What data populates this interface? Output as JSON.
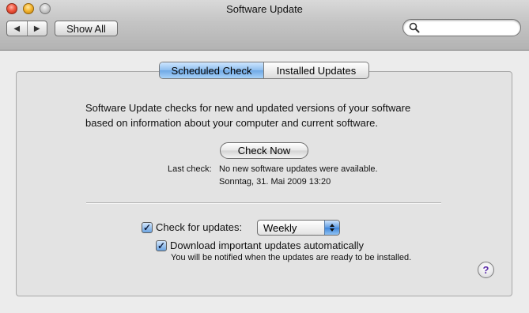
{
  "window": {
    "title": "Software Update"
  },
  "toolbar": {
    "back_icon": "triangle-left-icon",
    "forward_icon": "triangle-right-icon",
    "show_all_label": "Show All",
    "search_value": ""
  },
  "tabs": [
    {
      "label": "Scheduled Check",
      "selected": true
    },
    {
      "label": "Installed Updates",
      "selected": false
    }
  ],
  "main": {
    "description_line1": "Software Update checks for new and updated versions of your software",
    "description_line2": "based on information about your computer and current software.",
    "check_now_label": "Check Now",
    "last_check_label": "Last check:",
    "last_check_value": "No new software updates were available.",
    "last_check_date": "Sonntag, 31. Mai 2009 13:20"
  },
  "options": {
    "check_updates_label": "Check for updates:",
    "check_updates_checked": true,
    "frequency_selected": "Weekly",
    "download_label": "Download important updates automatically",
    "download_checked": true,
    "download_note": "You will be notified when the updates are ready to be installed."
  },
  "help": {
    "label": "?"
  },
  "colors": {
    "selected_tab": "#8ebeee",
    "checkbox_fill": "#6aa3e0",
    "help_mark": "#5a2aa8"
  }
}
